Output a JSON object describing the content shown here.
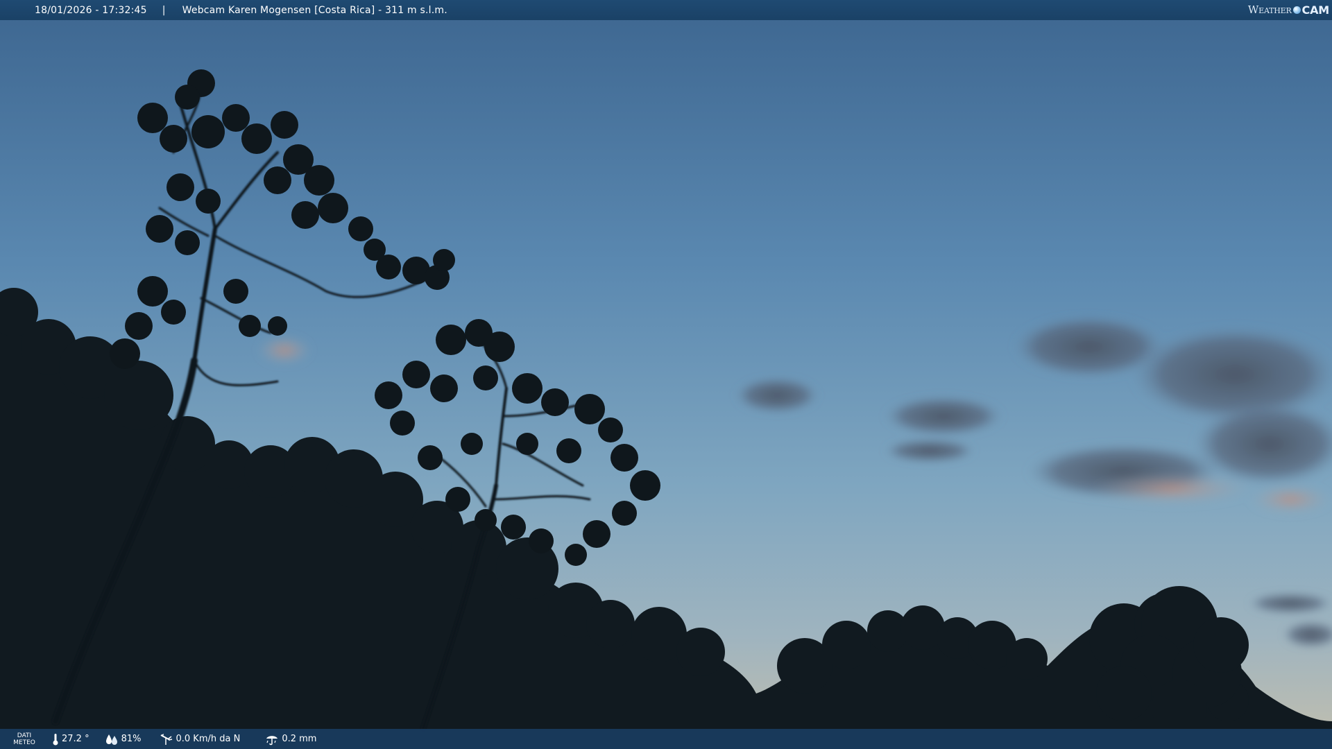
{
  "header": {
    "datetime": "18/01/2026 - 17:32:45",
    "separator": "|",
    "location": "Webcam Karen Mogensen [Costa Rica] - 311 m s.l.m.",
    "brand_weather": "Weather",
    "brand_cam": "CAM"
  },
  "footer": {
    "meteo_label_line1": "DATI",
    "meteo_label_line2": "METEO",
    "temperature": "27.2 °",
    "humidity": "81%",
    "wind": "0.0 Km/h da N",
    "rain": "0.2 mm"
  },
  "icons": {
    "temperature": "thermometer-icon",
    "humidity": "humidity-drops-icon",
    "wind": "wind-vane-icon",
    "rain": "rain-gauge-icon",
    "brand_globe": "globe-icon"
  },
  "colors": {
    "bar_background": "#1f4a72",
    "sky_top": "#3f6a93",
    "sky_mid": "#6e9bbd",
    "sky_horizon": "#a8b8bd",
    "sky_glow": "#c9b8a0",
    "foliage": "#121a1f",
    "cloud": "#4d5b6b",
    "cloud_glow": "#b48a7a"
  }
}
